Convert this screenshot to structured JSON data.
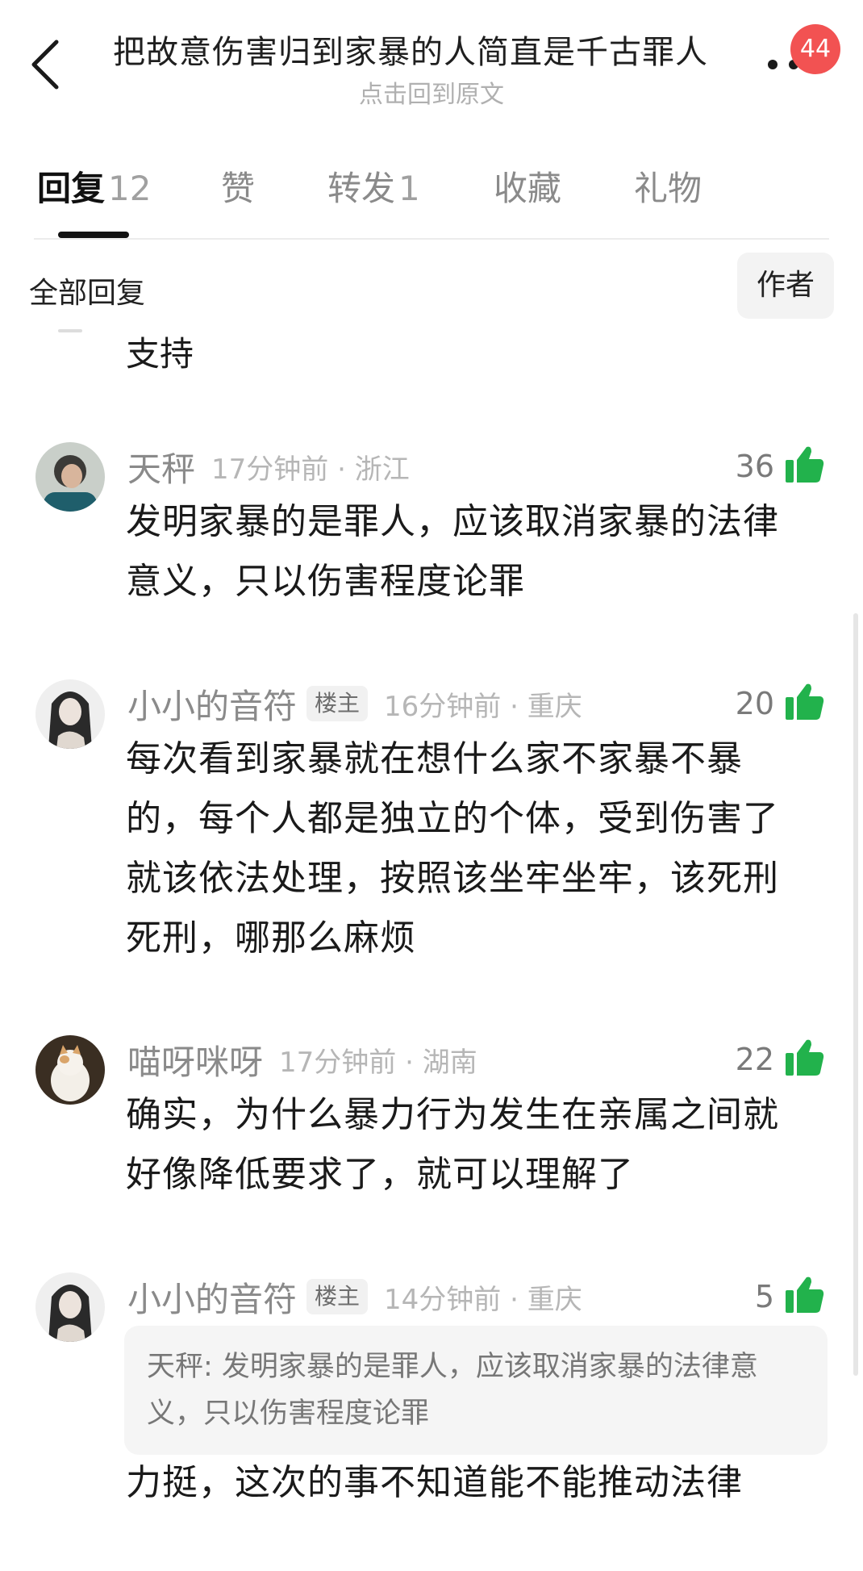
{
  "header": {
    "title": "把故意伤害归到家暴的人简直是千古罪人",
    "subtitle": "点击回到原文",
    "badge_count": "44",
    "back_icon": "chevron-left-icon",
    "more_icon": "more-dots-icon"
  },
  "tabs": [
    {
      "label": "回复",
      "count": "12",
      "active": true
    },
    {
      "label": "赞",
      "count": "",
      "active": false
    },
    {
      "label": "转发",
      "count": "1",
      "active": false
    },
    {
      "label": "收藏",
      "count": "",
      "active": false
    },
    {
      "label": "礼物",
      "count": "",
      "active": false
    }
  ],
  "filter": {
    "label": "全部回复",
    "author_button": "作者"
  },
  "partial_comment": {
    "text": "支持"
  },
  "comments": [
    {
      "user": "天秤",
      "op_tag": "",
      "time": "17分钟前 · 浙江",
      "likes": "36",
      "quote": "",
      "text": "发明家暴的是罪人，应该取消家暴的法律意义，只以伤害程度论罪"
    },
    {
      "user": "小小的音符",
      "op_tag": "楼主",
      "time": "16分钟前 · 重庆",
      "likes": "20",
      "quote": "",
      "text": "每次看到家暴就在想什么家不家暴不暴的，每个人都是独立的个体，受到伤害了就该依法处理，按照该坐牢坐牢，该死刑死刑，哪那么麻烦"
    },
    {
      "user": "喵呀咪呀",
      "op_tag": "",
      "time": "17分钟前 · 湖南",
      "likes": "22",
      "quote": "",
      "text": "确实，为什么暴力行为发生在亲属之间就好像降低要求了，就可以理解了"
    },
    {
      "user": "小小的音符",
      "op_tag": "楼主",
      "time": "14分钟前 · 重庆",
      "likes": "5",
      "quote": "天秤: 发明家暴的是罪人，应该取消家暴的法律意义，只以伤害程度论罪",
      "text": "力挺，这次的事不知道能不能推动法律"
    }
  ],
  "colors": {
    "like_green": "#22b24c",
    "badge_red": "#f25252"
  }
}
